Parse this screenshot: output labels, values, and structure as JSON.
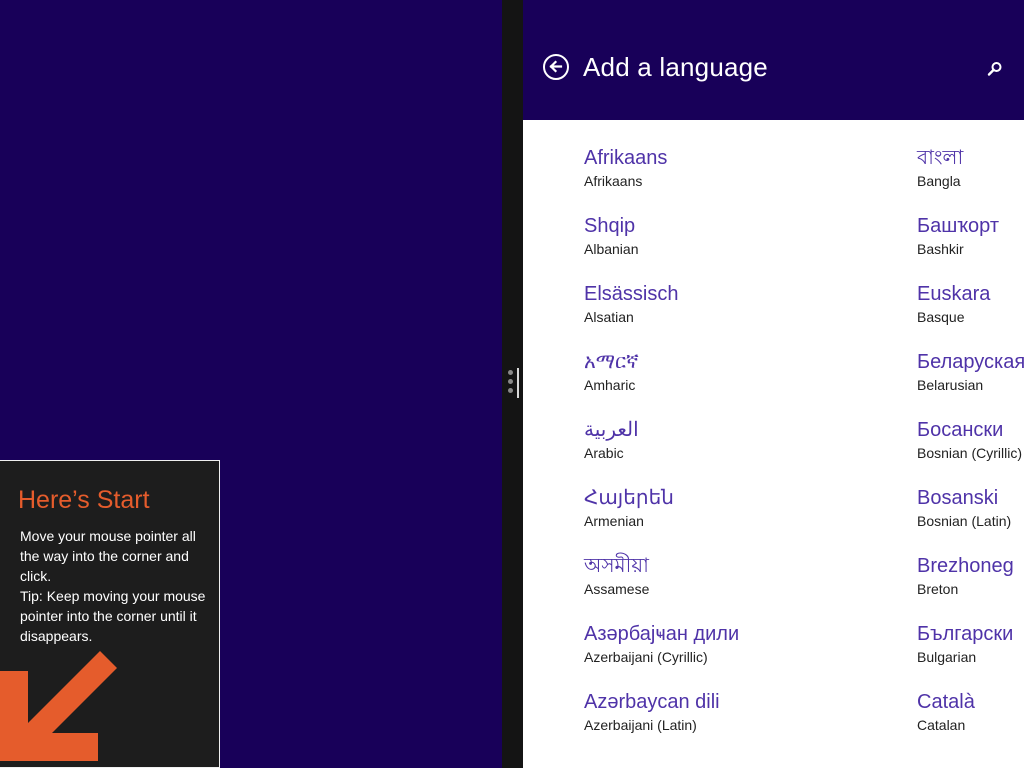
{
  "header": {
    "title": "Add a language",
    "back_icon": "back-arrow-icon",
    "search_icon": "search-icon"
  },
  "colors": {
    "accent": "#180059",
    "link": "#4f33a8",
    "tip_title": "#e55c2c",
    "tip_arrow": "#e55c2c"
  },
  "languages": {
    "column_1": [
      {
        "native": "Afrikaans",
        "english": "Afrikaans"
      },
      {
        "native": "Shqip",
        "english": "Albanian"
      },
      {
        "native": "Elsässisch",
        "english": "Alsatian"
      },
      {
        "native": "አማርኛ",
        "english": "Amharic"
      },
      {
        "native": "العربية",
        "english": "Arabic"
      },
      {
        "native": "Հայերեն",
        "english": "Armenian"
      },
      {
        "native": "অসমীয়া",
        "english": "Assamese"
      },
      {
        "native": "Азәрбајҹан дили",
        "english": "Azerbaijani (Cyrillic)"
      },
      {
        "native": "Azərbaycan dili",
        "english": "Azerbaijani (Latin)"
      }
    ],
    "column_2": [
      {
        "native": "বাংলা",
        "english": "Bangla"
      },
      {
        "native": "Башҡорт",
        "english": "Bashkir"
      },
      {
        "native": "Euskara",
        "english": "Basque"
      },
      {
        "native": "Беларуская",
        "english": "Belarusian"
      },
      {
        "native": "Босански",
        "english": "Bosnian (Cyrillic)"
      },
      {
        "native": "Bosanski",
        "english": "Bosnian (Latin)"
      },
      {
        "native": "Brezhoneg",
        "english": "Breton"
      },
      {
        "native": "Български",
        "english": "Bulgarian"
      },
      {
        "native": "Català",
        "english": "Catalan"
      }
    ]
  },
  "tip": {
    "title": "Here’s Start",
    "line1": "Move your mouse pointer all the way into the corner and click.",
    "line2": "Tip: Keep moving your mouse pointer into the corner until it disappears.",
    "arrow_icon": "arrow-down-left-icon"
  }
}
